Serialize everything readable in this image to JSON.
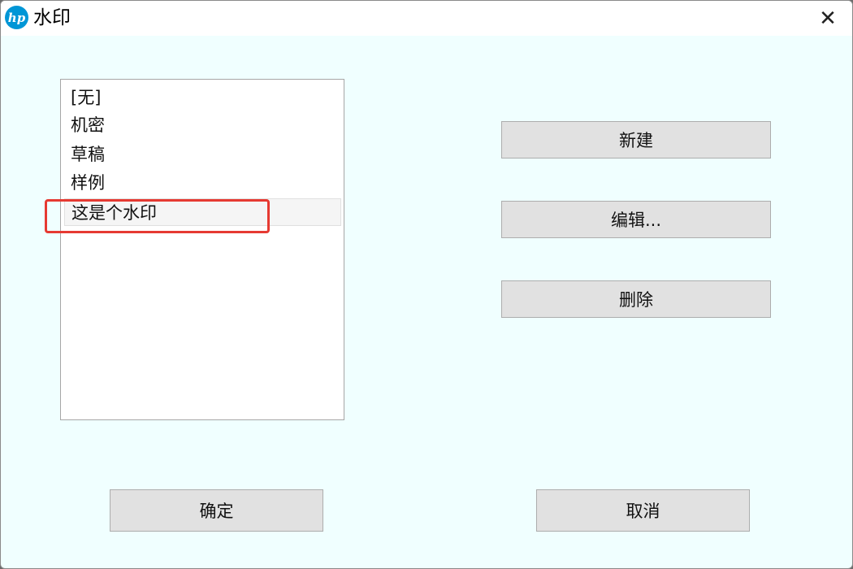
{
  "window": {
    "title": "水印",
    "close_label": "✕"
  },
  "watermark_list": {
    "items": [
      {
        "label": "[无]"
      },
      {
        "label": "机密"
      },
      {
        "label": "草稿"
      },
      {
        "label": "样例"
      },
      {
        "label": "这是个水印"
      }
    ],
    "selected_index": 4
  },
  "actions": {
    "new_label": "新建",
    "edit_label": "编辑...",
    "delete_label": "删除"
  },
  "footer": {
    "ok_label": "确定",
    "cancel_label": "取消"
  },
  "colors": {
    "dialog_background": "#f0ffff",
    "logo_blue": "#0096d6",
    "highlight_red": "#e63a32"
  }
}
